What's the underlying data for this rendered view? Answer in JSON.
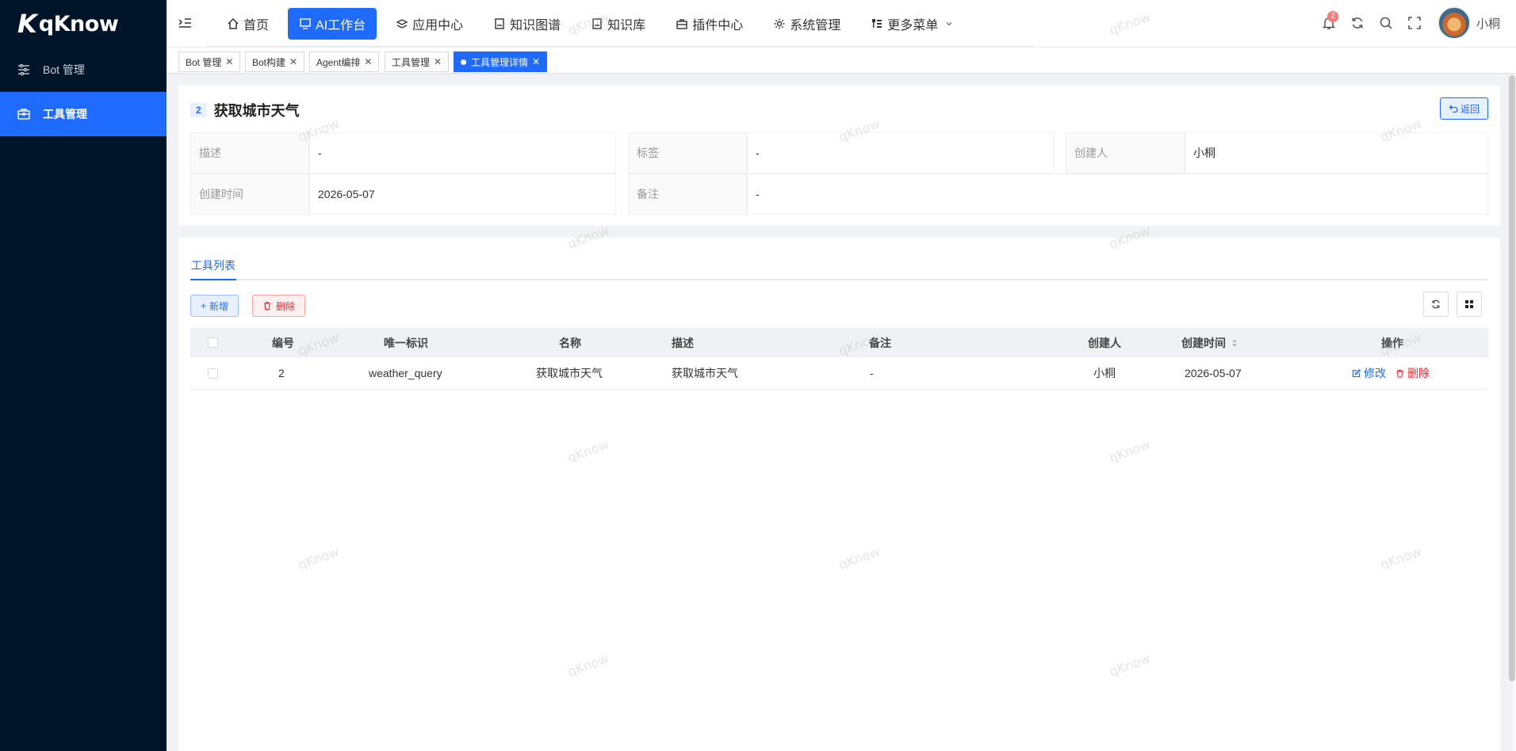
{
  "app": {
    "logo_text": "qKnow",
    "user_name": "小桐",
    "notification_count": "2"
  },
  "sidebar": {
    "items": [
      {
        "label": "Bot 管理"
      },
      {
        "label": "工具管理"
      }
    ]
  },
  "nav": {
    "items": [
      {
        "label": "首页"
      },
      {
        "label": "AI工作台"
      },
      {
        "label": "应用中心"
      },
      {
        "label": "知识图谱"
      },
      {
        "label": "知识库"
      },
      {
        "label": "插件中心"
      },
      {
        "label": "系统管理"
      },
      {
        "label": "更多菜单"
      }
    ]
  },
  "tags": [
    {
      "label": "Bot 管理"
    },
    {
      "label": "Bot构建"
    },
    {
      "label": "Agent编排"
    },
    {
      "label": "工具管理"
    },
    {
      "label": "工具管理详情"
    }
  ],
  "detail": {
    "id": "2",
    "title": "获取城市天气",
    "back_label": "返回",
    "fields": {
      "desc_label": "描述",
      "desc_value": "-",
      "tag_label": "标签",
      "tag_value": "-",
      "creator_label": "创建人",
      "creator_value": "小桐",
      "created_label": "创建时间",
      "created_value": "2026-05-07",
      "remark_label": "备注",
      "remark_value": "-"
    }
  },
  "tools": {
    "tab_label": "工具列表",
    "add_label": "新增",
    "delete_label": "删除",
    "columns": {
      "id": "编号",
      "uid": "唯一标识",
      "name": "名称",
      "desc": "描述",
      "remark": "备注",
      "creator": "创建人",
      "created": "创建时间",
      "action": "操作"
    },
    "rows": [
      {
        "id": "2",
        "uid": "weather_query",
        "name": "获取城市天气",
        "desc": "获取城市天气",
        "remark": "-",
        "creator": "小桐",
        "created": "2026-05-07",
        "edit_label": "修改",
        "delete_label": "删除"
      }
    ]
  },
  "watermark_text": "qKnow",
  "colors": {
    "primary": "#1f6bff",
    "sidebar_bg": "#001529",
    "danger": "#f5222d"
  }
}
